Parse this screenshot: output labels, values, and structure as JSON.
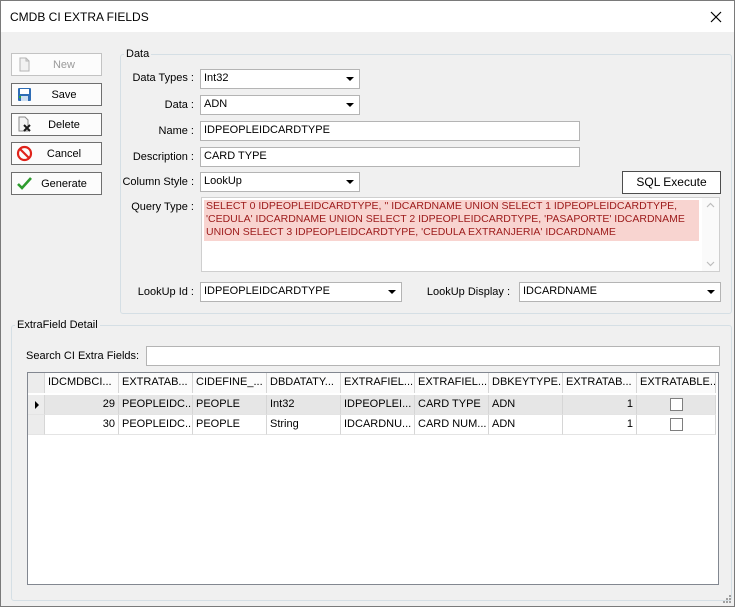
{
  "window": {
    "title": "CMDB CI EXTRA FIELDS"
  },
  "toolbar": {
    "new_label": "New",
    "save_label": "Save",
    "delete_label": "Delete",
    "cancel_label": "Cancel",
    "generate_label": "Generate"
  },
  "data_group": {
    "legend": "Data",
    "data_types": {
      "label": "Data Types :",
      "value": "Int32"
    },
    "data": {
      "label": "Data :",
      "value": "ADN"
    },
    "name": {
      "label": "Name :",
      "value": "IDPEOPLEIDCARDTYPE"
    },
    "description": {
      "label": "Description :",
      "value": "CARD TYPE"
    },
    "column_style": {
      "label": "Column Style :",
      "value": "LookUp"
    },
    "sql_execute_label": "SQL Execute",
    "query_type": {
      "label": "Query Type :",
      "value": "SELECT 0 IDPEOPLEIDCARDTYPE, '' IDCARDNAME UNION SELECT 1 IDPEOPLEIDCARDTYPE, 'CEDULA' IDCARDNAME UNION SELECT 2 IDPEOPLEIDCARDTYPE, 'PASAPORTE' IDCARDNAME UNION SELECT 3 IDPEOPLEIDCARDTYPE, 'CEDULA EXTRANJERIA' IDCARDNAME"
    },
    "lookup_id": {
      "label": "LookUp Id :",
      "value": "IDPEOPLEIDCARDTYPE"
    },
    "lookup_display": {
      "label": "LookUp Display :",
      "value": "IDCARDNAME"
    }
  },
  "detail_group": {
    "legend": "ExtraField Detail",
    "search": {
      "label": "Search CI Extra Fields:",
      "value": ""
    },
    "columns": [
      "IDCMDBCI...",
      "EXTRATAB...",
      "CIDEFINE_...",
      "DBDATATY...",
      "EXTRAFIEL...",
      "EXTRAFIEL...",
      "DBKEYTYPE...",
      "EXTRATAB...",
      "EXTRATABLE..."
    ],
    "rows": [
      {
        "current": true,
        "cells": [
          "29",
          "PEOPLEIDC...",
          "PEOPLE",
          "Int32",
          "IDPEOPLEI...",
          "CARD TYPE",
          "ADN",
          "1"
        ],
        "checked": false
      },
      {
        "current": false,
        "cells": [
          "30",
          "PEOPLEIDC...",
          "PEOPLE",
          "String",
          "IDCARDNU...",
          "CARD NUM...",
          "ADN",
          "1"
        ],
        "checked": false
      }
    ]
  }
}
